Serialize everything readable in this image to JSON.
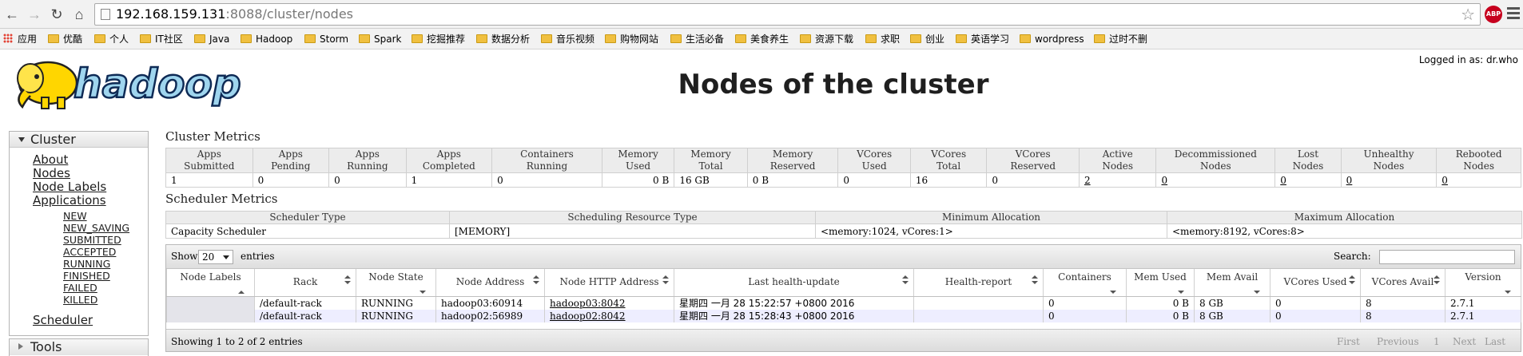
{
  "browser": {
    "url_host": "192.168.159.131",
    "url_path": ":8088/cluster/nodes",
    "abp_label": "ABP"
  },
  "bookmarks": [
    {
      "label": "应用",
      "icon": "apps-grid-icon"
    },
    {
      "label": "优酷",
      "icon": "folder-icon"
    },
    {
      "label": "个人",
      "icon": "folder-icon"
    },
    {
      "label": "IT社区",
      "icon": "folder-icon"
    },
    {
      "label": "Java",
      "icon": "folder-icon"
    },
    {
      "label": "Hadoop",
      "icon": "folder-icon"
    },
    {
      "label": "Storm",
      "icon": "folder-icon"
    },
    {
      "label": "Spark",
      "icon": "folder-icon"
    },
    {
      "label": "挖掘推荐",
      "icon": "folder-icon"
    },
    {
      "label": "数据分析",
      "icon": "folder-icon"
    },
    {
      "label": "音乐视频",
      "icon": "folder-icon"
    },
    {
      "label": "购物网站",
      "icon": "folder-icon"
    },
    {
      "label": "生活必备",
      "icon": "folder-icon"
    },
    {
      "label": "美食养生",
      "icon": "folder-icon"
    },
    {
      "label": "资源下载",
      "icon": "folder-icon"
    },
    {
      "label": "求职",
      "icon": "folder-icon"
    },
    {
      "label": "创业",
      "icon": "folder-icon"
    },
    {
      "label": "英语学习",
      "icon": "folder-icon"
    },
    {
      "label": "wordpress",
      "icon": "folder-icon"
    },
    {
      "label": "过时不删",
      "icon": "folder-icon"
    }
  ],
  "header": {
    "logo_text": "hadoop",
    "title": "Nodes of the cluster",
    "logged_in": "Logged in as: dr.who"
  },
  "sidebar": {
    "cluster_label": "Cluster",
    "links": [
      "About",
      "Nodes",
      "Node Labels",
      "Applications"
    ],
    "app_states": [
      "NEW",
      "NEW_SAVING",
      "SUBMITTED",
      "ACCEPTED",
      "RUNNING",
      "FINISHED",
      "FAILED",
      "KILLED"
    ],
    "scheduler_label": "Scheduler",
    "tools_label": "Tools"
  },
  "cluster_metrics": {
    "title": "Cluster Metrics",
    "headers": [
      [
        "Apps",
        "Submitted"
      ],
      [
        "Apps",
        "Pending"
      ],
      [
        "Apps",
        "Running"
      ],
      [
        "Apps",
        "Completed"
      ],
      [
        "Containers",
        "Running"
      ],
      [
        "Memory",
        "Used"
      ],
      [
        "Memory",
        "Total"
      ],
      [
        "Memory",
        "Reserved"
      ],
      [
        "VCores",
        "Used"
      ],
      [
        "VCores",
        "Total"
      ],
      [
        "VCores",
        "Reserved"
      ],
      [
        "Active",
        "Nodes"
      ],
      [
        "Decommissioned",
        "Nodes"
      ],
      [
        "Lost",
        "Nodes"
      ],
      [
        "Unhealthy",
        "Nodes"
      ],
      [
        "Rebooted",
        "Nodes"
      ]
    ],
    "values": [
      "1",
      "0",
      "0",
      "1",
      "0",
      "0 B",
      "16 GB",
      "0 B",
      "0",
      "16",
      "0",
      "2",
      "0",
      "0",
      "0",
      "0"
    ]
  },
  "scheduler_metrics": {
    "title": "Scheduler Metrics",
    "headers": [
      "Scheduler Type",
      "Scheduling Resource Type",
      "Minimum Allocation",
      "Maximum Allocation"
    ],
    "values": [
      "Capacity Scheduler",
      "[MEMORY]",
      "<memory:1024, vCores:1>",
      "<memory:8192, vCores:8>"
    ]
  },
  "nodes_table": {
    "show_label": "Show",
    "entries_value": "20",
    "entries_label": "entries",
    "search_label": "Search:",
    "headers": [
      "Node Labels",
      "Rack",
      "Node State",
      "Node Address",
      "Node HTTP Address",
      "Last health-update",
      "Health-report",
      "Containers",
      "Mem Used",
      "Mem Avail",
      "VCores Used",
      "VCores Avail",
      "Version"
    ],
    "rows": [
      [
        "",
        "/default-rack",
        "RUNNING",
        "hadoop03:60914",
        "hadoop03:8042",
        "星期四 一月 28 15:22:57 +0800 2016",
        "",
        "0",
        "0 B",
        "8 GB",
        "0",
        "8",
        "2.7.1"
      ],
      [
        "",
        "/default-rack",
        "RUNNING",
        "hadoop02:56989",
        "hadoop02:8042",
        "星期四 一月 28 15:28:43 +0800 2016",
        "",
        "0",
        "0 B",
        "8 GB",
        "0",
        "8",
        "2.7.1"
      ]
    ],
    "info": "Showing 1 to 2 of 2 entries",
    "pager": [
      "First",
      "Previous",
      "1",
      "Next",
      "Last"
    ]
  }
}
